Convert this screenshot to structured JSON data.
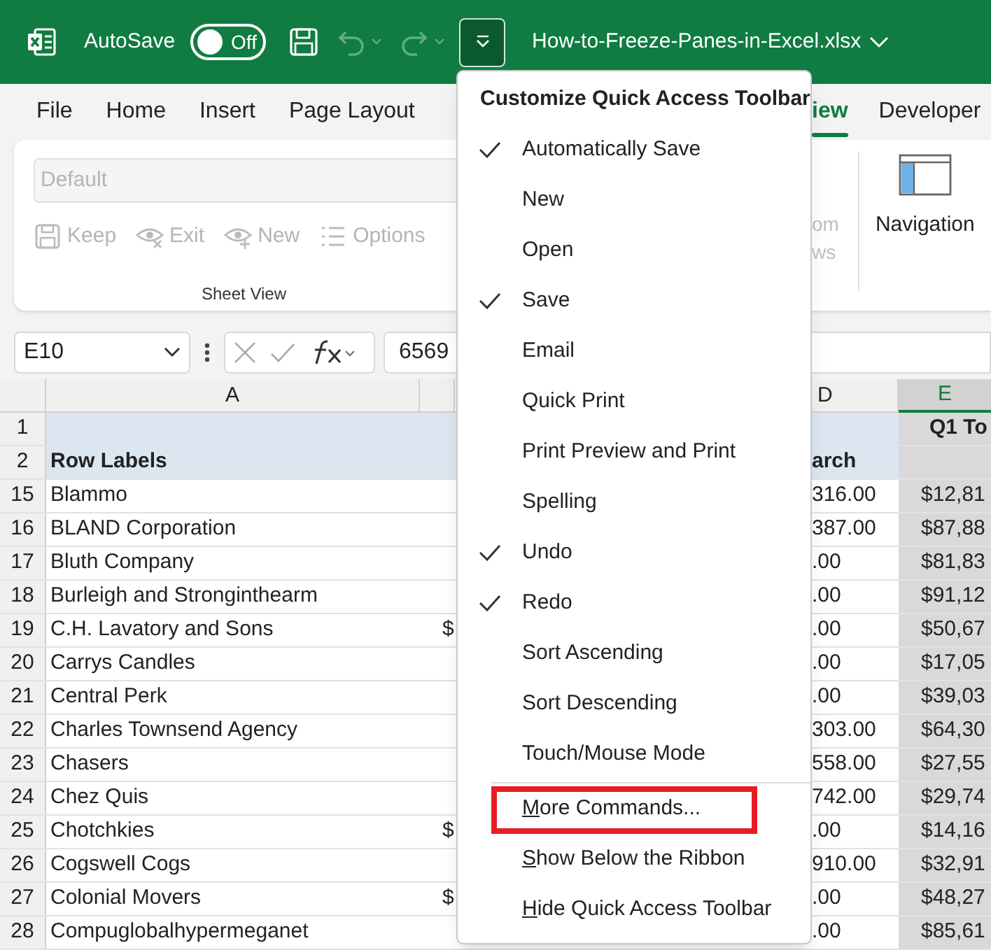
{
  "title_bar": {
    "autosave": {
      "label": "AutoSave",
      "on": false,
      "state_text": "Off"
    },
    "quick_access": [
      {
        "kind": "save",
        "disabled": false
      },
      {
        "kind": "undo",
        "disabled": true
      },
      {
        "kind": "redo",
        "disabled": true
      }
    ],
    "customize_button": {
      "selected": true
    },
    "file_name": "How-to-Freeze-Panes-in-Excel.xlsx"
  },
  "ribbon_tabs": [
    {
      "label": "File",
      "selected": false
    },
    {
      "label": "Home",
      "selected": false
    },
    {
      "label": "Insert",
      "selected": false
    },
    {
      "label": "Page Layout",
      "selected": false
    },
    {
      "label": "iew",
      "selected": true
    },
    {
      "label": "Developer",
      "selected": false
    }
  ],
  "ribbon": {
    "sheet_view": {
      "dropdown": {
        "placeholder": "Default",
        "disabled": true
      },
      "buttons": [
        {
          "kind": "keep",
          "label": "Keep",
          "disabled": true
        },
        {
          "kind": "exit",
          "label": "Exit",
          "disabled": true
        },
        {
          "kind": "new",
          "label": "New",
          "disabled": true
        },
        {
          "kind": "options",
          "label": "Options",
          "disabled": true
        }
      ],
      "group_label": "Sheet View"
    },
    "partial_labels": [
      "om",
      "ws"
    ],
    "navigation": {
      "label": "Navigation"
    }
  },
  "formula_bar": {
    "name_box": "E10",
    "value": "6569"
  },
  "columns": [
    {
      "label": "A",
      "selected": false
    },
    {
      "label": "D",
      "selected": false
    },
    {
      "label": "E",
      "selected": true
    }
  ],
  "header_rows": [
    {
      "num": "1",
      "col_e": "Q1 To"
    },
    {
      "num": "2",
      "col_a": "Row Labels",
      "col_d": "arch"
    }
  ],
  "rows": [
    {
      "num": "15",
      "col_a": "Blammo",
      "col_d": "316.00",
      "col_e": "$12,81"
    },
    {
      "num": "16",
      "col_a": "BLAND Corporation",
      "col_d": "387.00",
      "col_e": "$87,88"
    },
    {
      "num": "17",
      "col_a": "Bluth Company",
      "col_d": ".00",
      "col_e": "$81,83"
    },
    {
      "num": "18",
      "col_a": "Burleigh and Stronginthearm",
      "col_d": ".00",
      "col_e": "$91,12"
    },
    {
      "num": "19",
      "col_a": "C.H. Lavatory and Sons",
      "col_b": "$",
      "col_d": ".00",
      "col_e": "$50,67"
    },
    {
      "num": "20",
      "col_a": "Carrys Candles",
      "col_d": ".00",
      "col_e": "$17,05"
    },
    {
      "num": "21",
      "col_a": "Central Perk",
      "col_d": ".00",
      "col_e": "$39,03"
    },
    {
      "num": "22",
      "col_a": "Charles Townsend Agency",
      "col_d": "303.00",
      "col_e": "$64,30"
    },
    {
      "num": "23",
      "col_a": "Chasers",
      "col_d": "558.00",
      "col_e": "$27,55"
    },
    {
      "num": "24",
      "col_a": "Chez Quis",
      "col_d": "742.00",
      "col_e": "$29,74"
    },
    {
      "num": "25",
      "col_a": "Chotchkies",
      "col_b": "$",
      "col_d": ".00",
      "col_e": "$14,16"
    },
    {
      "num": "26",
      "col_a": "Cogswell Cogs",
      "col_d": "910.00",
      "col_e": "$32,91"
    },
    {
      "num": "27",
      "col_a": "Colonial Movers",
      "col_b": "$",
      "col_d": ".00",
      "col_e": "$48,27"
    },
    {
      "num": "28",
      "col_a": "Compuglobalhypermeganet",
      "col_d": ".00",
      "col_e": "$85,61"
    }
  ],
  "menu": {
    "title": "Customize Quick Access Toolbar",
    "items": [
      {
        "label": "Automatically Save",
        "checked": true
      },
      {
        "label": "New",
        "checked": false
      },
      {
        "label": "Open",
        "checked": false
      },
      {
        "label": "Save",
        "checked": true
      },
      {
        "label": "Email",
        "checked": false
      },
      {
        "label": "Quick Print",
        "checked": false
      },
      {
        "label": "Print Preview and Print",
        "checked": false
      },
      {
        "label": "Spelling",
        "checked": false
      },
      {
        "label": "Undo",
        "checked": true
      },
      {
        "label": "Redo",
        "checked": true
      },
      {
        "label": "Sort Ascending",
        "checked": false
      },
      {
        "label": "Sort Descending",
        "checked": false
      },
      {
        "label": "Touch/Mouse Mode",
        "checked": false
      }
    ],
    "commands": [
      {
        "label": "More Commands...",
        "mnemonic": true,
        "highlighted": true
      },
      {
        "label": "Show Below the Ribbon",
        "mnemonic": true,
        "highlighted": false
      },
      {
        "label": "Hide Quick Access Toolbar",
        "mnemonic": true,
        "highlighted": false
      }
    ]
  }
}
